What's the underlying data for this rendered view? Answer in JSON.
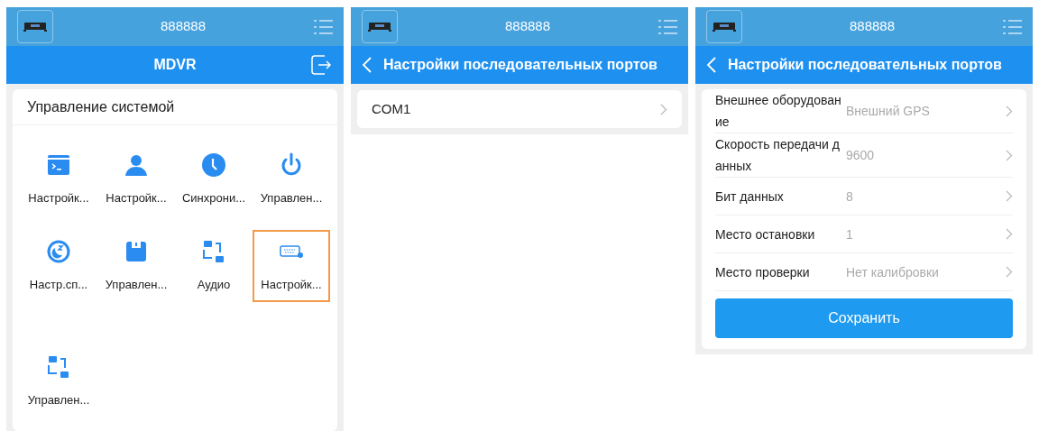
{
  "screens": [
    {
      "kind": "menu",
      "device": "888888",
      "title": "MDVR",
      "section": "Управление системой",
      "items": [
        {
          "label": "Настройк...",
          "selected": false
        },
        {
          "label": "Настройк...",
          "selected": false
        },
        {
          "label": "Синхрони...",
          "selected": false
        },
        {
          "label": "Управлен...",
          "selected": false
        },
        {
          "label": "Настр.сп...",
          "selected": false
        },
        {
          "label": "Управлен...",
          "selected": false
        },
        {
          "label": "Аудио",
          "selected": false
        },
        {
          "label": "Настройк...",
          "selected": true
        },
        {
          "label": "Управлен...",
          "selected": false
        }
      ]
    },
    {
      "kind": "list",
      "device": "888888",
      "title": "Настройки последовательных портов",
      "rows": [
        {
          "label": "COM1"
        }
      ]
    },
    {
      "kind": "form",
      "device": "888888",
      "title": "Настройки последовательных портов",
      "rows": [
        {
          "label": "Внешнее оборудование",
          "value": "Внешний GPS"
        },
        {
          "label": "Скорость передачи данных",
          "value": "9600"
        },
        {
          "label": "Бит данных",
          "value": "8"
        },
        {
          "label": "Место остановки",
          "value": "1"
        },
        {
          "label": "Место проверки",
          "value": "Нет калибровки"
        }
      ],
      "save_button": "Сохранить"
    }
  ]
}
